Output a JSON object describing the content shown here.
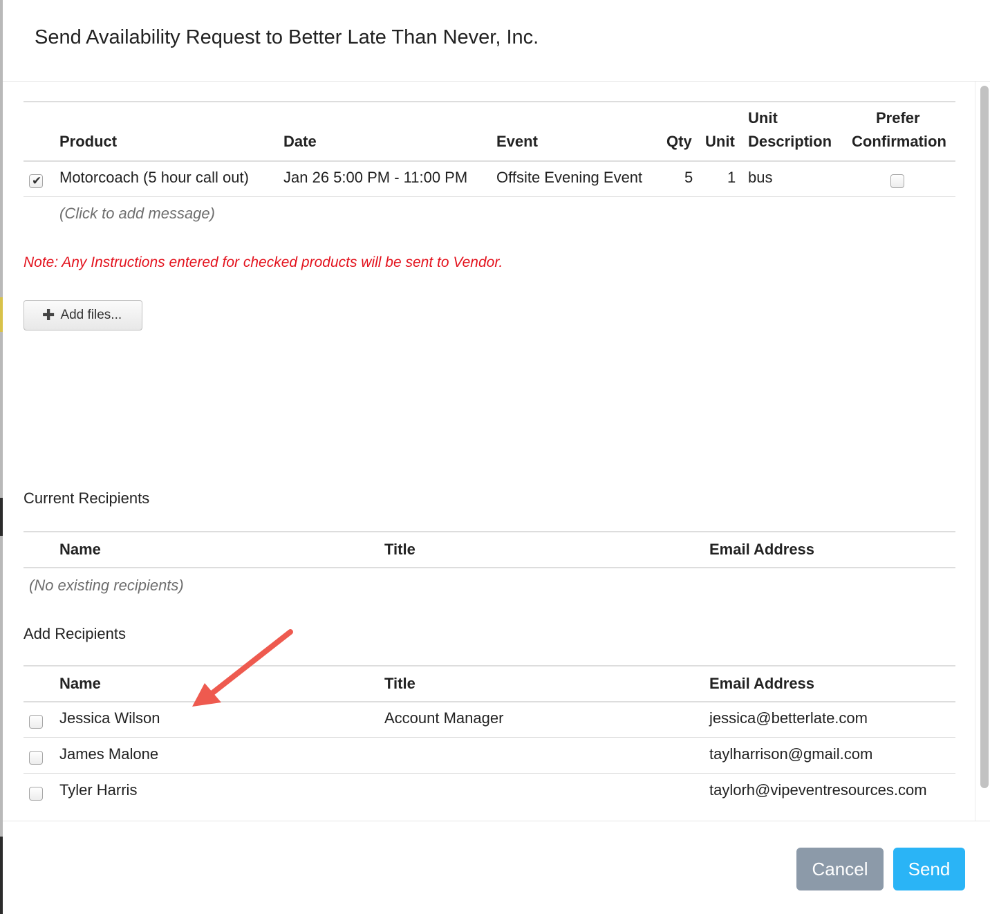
{
  "dialog": {
    "title": "Send Availability Request to Better Late Than Never, Inc."
  },
  "products": {
    "columns": {
      "product": "Product",
      "date": "Date",
      "event": "Event",
      "qty": "Qty",
      "unit": "Unit",
      "unit_description_line1": "Unit",
      "unit_description_line2": "Description",
      "prefer_confirmation_line1": "Prefer",
      "prefer_confirmation_line2": "Confirmation"
    },
    "rows": [
      {
        "checked": true,
        "product": "Motorcoach (5 hour call out)",
        "date": "Jan 26 5:00 PM - 11:00 PM",
        "event": "Offsite Evening Event",
        "qty": "5",
        "unit": "1",
        "unit_description": "bus",
        "prefer_confirmation": false
      }
    ],
    "message_placeholder": "(Click to add message)"
  },
  "note": "Note: Any Instructions entered for checked products will be sent to Vendor.",
  "add_files_label": "Add files...",
  "current_recipients": {
    "title": "Current Recipients",
    "columns": {
      "name": "Name",
      "title": "Title",
      "email": "Email Address"
    },
    "empty_text": "(No existing recipients)"
  },
  "add_recipients": {
    "title": "Add Recipients",
    "columns": {
      "name": "Name",
      "title": "Title",
      "email": "Email Address"
    },
    "rows": [
      {
        "checked": false,
        "name": "Jessica Wilson",
        "title": "Account Manager",
        "email": "jessica@betterlate.com"
      },
      {
        "checked": false,
        "name": "James Malone",
        "title": "",
        "email": "taylharrison@gmail.com"
      },
      {
        "checked": false,
        "name": "Tyler Harris",
        "title": "",
        "email": "taylorh@vipeventresources.com"
      }
    ]
  },
  "footer": {
    "cancel_label": "Cancel",
    "send_label": "Send"
  },
  "colors": {
    "note_red": "#e3121d",
    "cancel_gray": "#8c9aa9",
    "send_blue": "#2ab4f6",
    "arrow_red": "#ee5a4f"
  },
  "icons": {
    "add_files": "plus-icon",
    "checkbox_checked": "checkmark-icon",
    "annotation": "arrow-icon"
  }
}
